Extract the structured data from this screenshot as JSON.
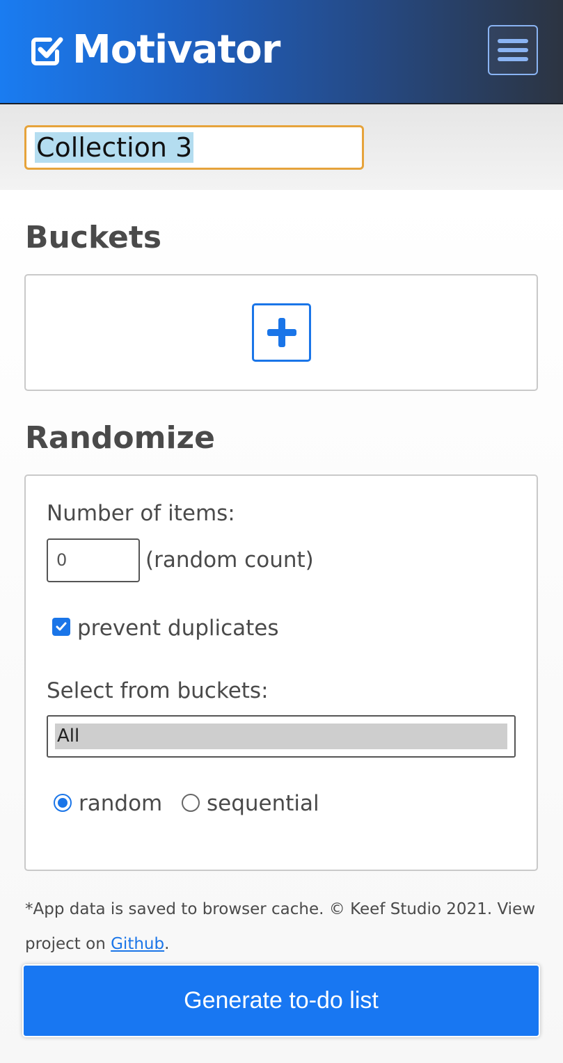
{
  "header": {
    "app_title": "Motivator",
    "logo_icon": "check-square-icon",
    "menu_icon": "hamburger-icon"
  },
  "collection": {
    "name_value": "Collection 3"
  },
  "buckets": {
    "title": "Buckets",
    "add_icon": "plus-icon"
  },
  "randomize": {
    "title": "Randomize",
    "number_label": "Number of items:",
    "count_value": "0",
    "count_hint": "(random count)",
    "prevent_duplicates_label": "prevent duplicates",
    "prevent_duplicates_checked": true,
    "select_label": "Select from buckets:",
    "select_value": "All",
    "order_options": [
      "random",
      "sequential"
    ],
    "order_selected": "random"
  },
  "footer": {
    "note_prefix": "*App data is saved to browser cache. © Keef Studio 2021. View project on ",
    "link_text": "Github",
    "note_suffix": "."
  },
  "actions": {
    "generate_label": "Generate to-do list"
  },
  "colors": {
    "accent": "#1a75e8",
    "focus_border": "#e6a33b",
    "selection_highlight": "#b4ddf0"
  }
}
